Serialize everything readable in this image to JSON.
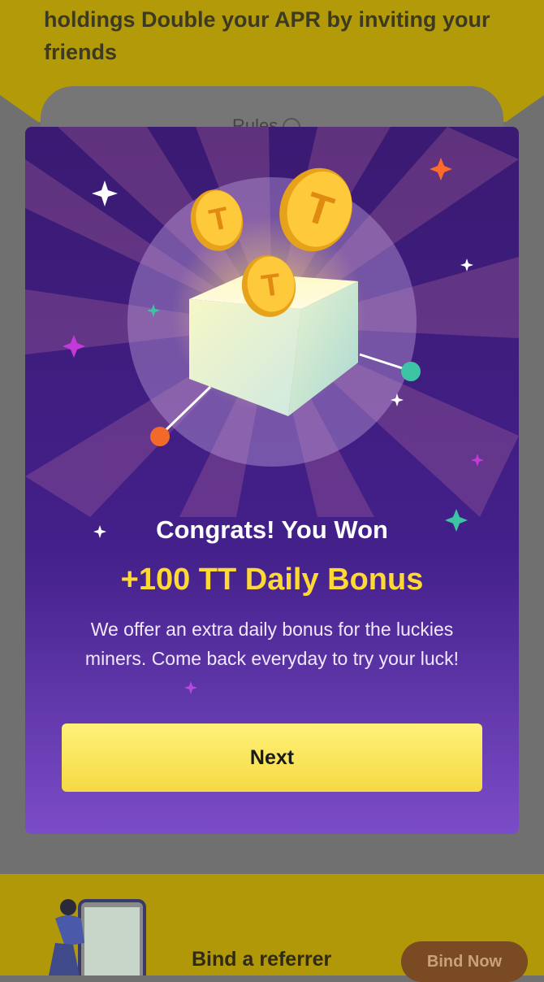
{
  "background": {
    "header_text": "holdings Double your APR by inviting your friends",
    "rules_label": "Rules",
    "bind_referrer_label": "Bind a referrer",
    "bind_now_label": "Bind Now"
  },
  "modal": {
    "title": "Congrats! You Won",
    "bonus": "+100 TT Daily Bonus",
    "description": "We offer an extra daily bonus for the luckies miners. Come back everyday to try your luck!",
    "next_label": "Next",
    "coin_letter": "T"
  },
  "colors": {
    "modal_bg": "#43208a",
    "bonus_text": "#ffd933",
    "button": "#f5d942"
  }
}
